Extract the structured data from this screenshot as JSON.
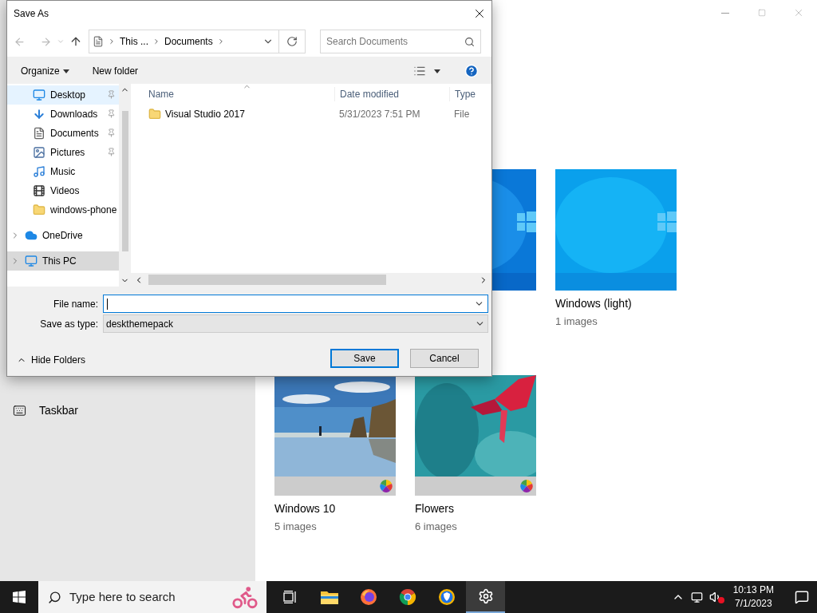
{
  "settings_window": {
    "sidebar": {
      "items": [
        {
          "label": "Taskbar"
        }
      ]
    },
    "themes": [
      {
        "kind": "hidden"
      },
      {
        "kind": "wallpaper"
      },
      {
        "kind": "wallpaper",
        "name": "Windows (light)",
        "count": "1 images"
      },
      {
        "name": "Windows 10",
        "count": "5 images"
      },
      {
        "name": "Flowers",
        "count": "6 images"
      }
    ]
  },
  "dialog": {
    "title": "Save As",
    "breadcrumb": [
      "This ...",
      "Documents"
    ],
    "search": {
      "placeholder": "Search Documents"
    },
    "toolbar": {
      "organize": "Organize",
      "new_folder": "New folder"
    },
    "nav_pane": {
      "items": [
        {
          "kind": "quick",
          "label": "Desktop",
          "pinned": true,
          "hovered": true,
          "selected": false
        },
        {
          "kind": "quick",
          "label": "Downloads",
          "pinned": true,
          "hovered": false,
          "selected": false
        },
        {
          "kind": "quick",
          "label": "Documents",
          "pinned": true,
          "hovered": false,
          "selected": false
        },
        {
          "kind": "quick",
          "label": "Pictures",
          "pinned": true,
          "hovered": false,
          "selected": false
        },
        {
          "kind": "quick",
          "label": "Music",
          "pinned": false,
          "hovered": false,
          "selected": false
        },
        {
          "kind": "quick",
          "label": "Videos",
          "pinned": false,
          "hovered": false,
          "selected": false
        },
        {
          "kind": "quick",
          "label": "windows-phone",
          "pinned": false,
          "hovered": false,
          "selected": false
        },
        {
          "kind": "root",
          "label": "OneDrive",
          "pinned": false,
          "hovered": false,
          "selected": false
        },
        {
          "kind": "root",
          "label": "This PC",
          "pinned": false,
          "hovered": false,
          "selected": true
        }
      ]
    },
    "table": {
      "columns": [
        "Name",
        "Date modified",
        "Type"
      ],
      "rows": [
        {
          "name": "Visual Studio 2017",
          "date": "5/31/2023 7:51 PM",
          "type": "File"
        }
      ]
    },
    "file_name": {
      "label": "File name:"
    },
    "save_as_type": {
      "label": "Save as type:",
      "value": "deskthemepack"
    },
    "hide_folders": "Hide Folders",
    "buttons": [
      {
        "label": "Save",
        "default": true
      },
      {
        "label": "Cancel",
        "default": false
      }
    ]
  },
  "taskbar": {
    "search": {
      "placeholder": "Type here to search"
    },
    "apps": [
      {
        "active": false
      },
      {
        "active": false
      },
      {
        "active": false
      },
      {
        "active": false
      },
      {
        "active": false
      },
      {
        "active": true
      }
    ],
    "clock": {
      "time": "10:13 PM",
      "date": "7/1/2023"
    }
  }
}
